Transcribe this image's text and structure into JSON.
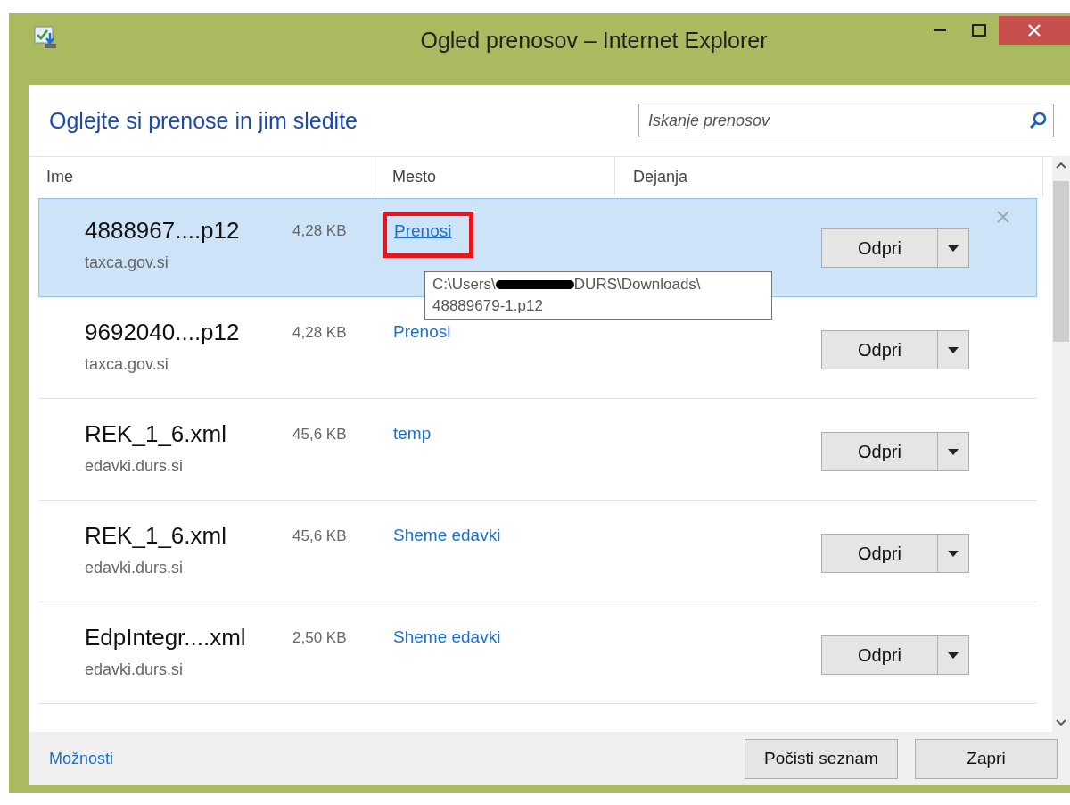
{
  "window": {
    "title": "Ogled prenosov – Internet Explorer"
  },
  "heading": "Oglejte si prenose in jim sledite",
  "search": {
    "placeholder": "Iskanje prenosov"
  },
  "columns": [
    "Ime",
    "Mesto",
    "Dejanja"
  ],
  "rows": [
    {
      "name": "4888967....p12",
      "size": "4,28 KB",
      "origin": "taxca.gov.si",
      "location": "Prenosi",
      "action": "Odpri",
      "selected": true,
      "highlighted": true
    },
    {
      "name": "9692040....p12",
      "size": "4,28 KB",
      "origin": "taxca.gov.si",
      "location": "Prenosi",
      "action": "Odpri",
      "selected": false,
      "highlighted": false
    },
    {
      "name": "REK_1_6.xml",
      "size": "45,6 KB",
      "origin": "edavki.durs.si",
      "location": "temp",
      "action": "Odpri",
      "selected": false,
      "highlighted": false
    },
    {
      "name": "REK_1_6.xml",
      "size": "45,6 KB",
      "origin": "edavki.durs.si",
      "location": "Sheme edavki",
      "action": "Odpri",
      "selected": false,
      "highlighted": false
    },
    {
      "name": "EdpIntegr....xml",
      "size": "2,50 KB",
      "origin": "edavki.durs.si",
      "location": "Sheme edavki",
      "action": "Odpri",
      "selected": false,
      "highlighted": false
    }
  ],
  "tooltip": {
    "path_start": "C:\\Users\\",
    "path_end": "DURS\\Downloads\\",
    "file": "48889679-1.p12"
  },
  "footer": {
    "link": "Možnosti",
    "buttons": [
      "Počisti seznam",
      "Zapri"
    ]
  }
}
